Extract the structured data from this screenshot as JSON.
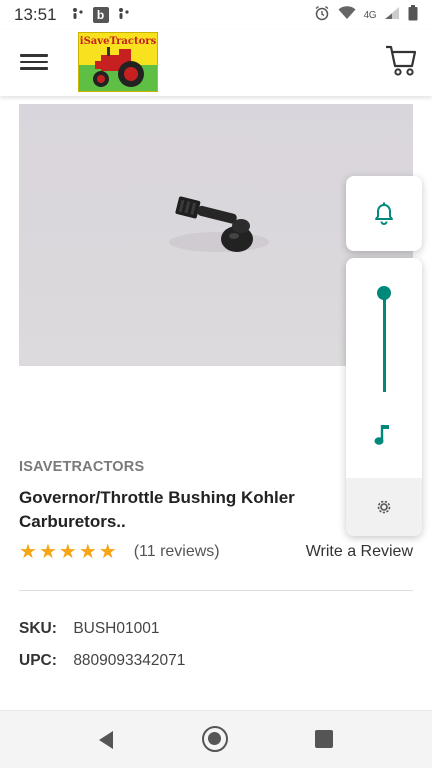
{
  "status_bar": {
    "time": "13:51",
    "network": "4G"
  },
  "header": {
    "logo_text": "iSaveTractors",
    "colors": {
      "logo_yellow": "#f8e21f",
      "logo_green": "#5fbf44",
      "logo_red": "#c62020"
    }
  },
  "product": {
    "brand": "ISAVETRACTORS",
    "title": "Governor/Throttle Bushing Kohler Carburetors..",
    "rating_stars": 5,
    "reviews": "(11 reviews)",
    "write_review": "Write a Review",
    "sku_label": "SKU:",
    "sku": "BUSH01001",
    "upc_label": "UPC:",
    "upc": "8809093342071"
  },
  "volume_panel": {
    "accent": "#00897b",
    "level": 1.0,
    "icons": [
      "bell-icon",
      "music-note-icon",
      "gear-icon"
    ]
  },
  "colors": {
    "star": "#f5a516",
    "accent": "#00897b"
  }
}
